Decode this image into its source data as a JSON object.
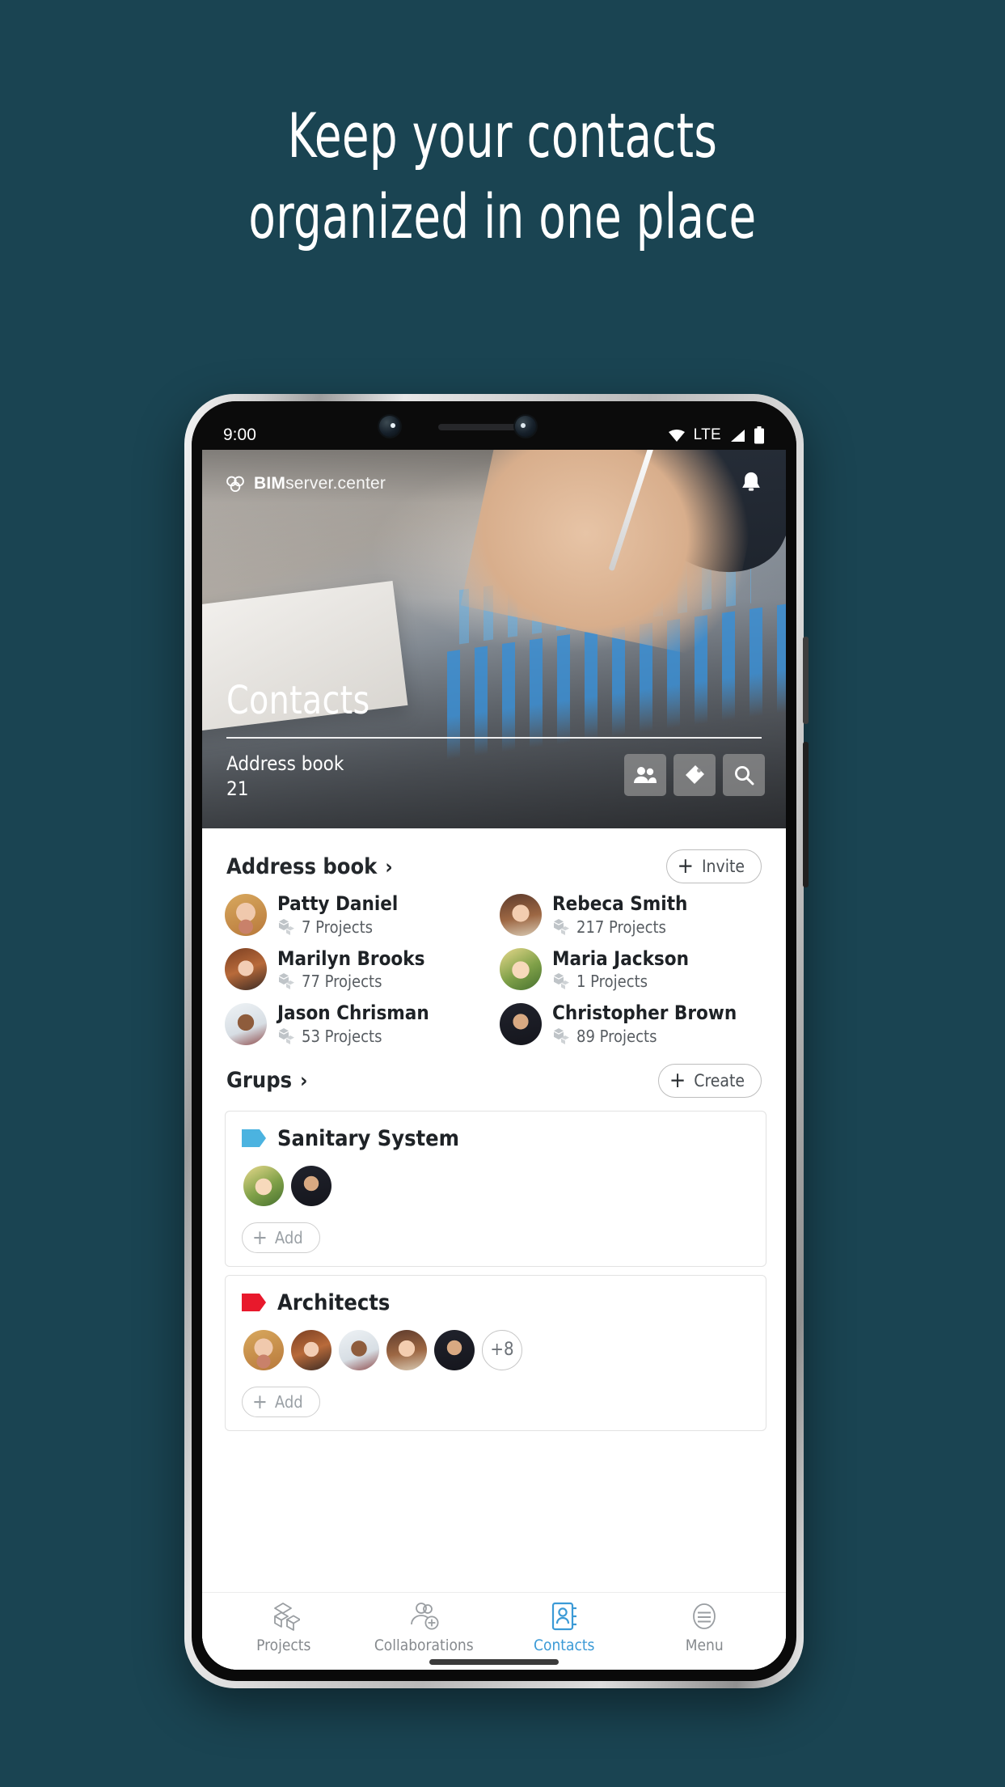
{
  "promo": {
    "headline_line1": "Keep your contacts",
    "headline_line2": "organized in one place",
    "background_color": "#1a4452"
  },
  "status_bar": {
    "time": "9:00",
    "network": "LTE",
    "icons": [
      "wifi-icon",
      "lte-label",
      "signal-icon",
      "battery-icon"
    ]
  },
  "app_bar": {
    "brand_bold": "BIM",
    "brand_light": "server.center",
    "notification_icon": "bell-icon"
  },
  "hero": {
    "title": "Contacts",
    "subtitle_label": "Address book",
    "subtitle_count": "21",
    "actions": [
      {
        "name": "people-icon"
      },
      {
        "name": "tag-icon"
      },
      {
        "name": "search-icon"
      }
    ]
  },
  "address_book": {
    "title": "Address book",
    "chevron": "›",
    "invite_label": "Invite",
    "contacts": [
      {
        "name": "Patty Daniel",
        "projects": "7 Projects"
      },
      {
        "name": "Rebeca Smith",
        "projects": "217 Projects"
      },
      {
        "name": "Marilyn Brooks",
        "projects": "77 Projects"
      },
      {
        "name": "Maria Jackson",
        "projects": "1 Projects"
      },
      {
        "name": "Jason Chrisman",
        "projects": "53 Projects"
      },
      {
        "name": "Christopher Brown",
        "projects": "89 Projects"
      }
    ]
  },
  "groups": {
    "title": "Grups",
    "chevron": "›",
    "create_label": "Create",
    "items": [
      {
        "name": "Sanitary System",
        "tag_color": "#4bb3e0",
        "member_count": 2,
        "overflow": "",
        "add_label": "Add"
      },
      {
        "name": "Architects",
        "tag_color": "#e8192c",
        "member_count": 5,
        "overflow": "+8",
        "add_label": "Add"
      }
    ]
  },
  "bottom_nav": {
    "active": "Contacts",
    "accent_color": "#3b9ad6",
    "items": [
      {
        "label": "Projects",
        "icon": "cubes-icon"
      },
      {
        "label": "Collaborations",
        "icon": "people-add-icon"
      },
      {
        "label": "Contacts",
        "icon": "address-book-icon"
      },
      {
        "label": "Menu",
        "icon": "menu-icon"
      }
    ]
  }
}
